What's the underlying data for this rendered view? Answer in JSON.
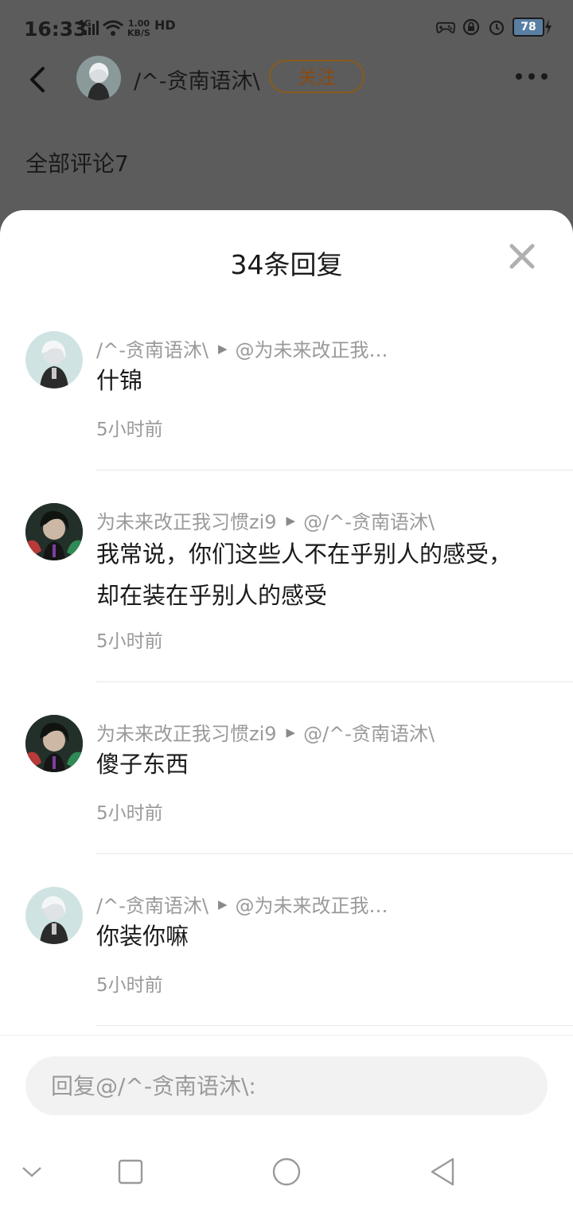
{
  "status_bar": {
    "time": "16:33",
    "network": "4G",
    "speed_value": "1.00",
    "speed_unit": "KB/S",
    "hd": "HD",
    "battery": "78"
  },
  "nav": {
    "name": "/^-贪南语沐\\",
    "follow_label": "关注"
  },
  "page": {
    "all_comments": "全部评论7"
  },
  "sheet": {
    "title": "34条回复"
  },
  "replies": [
    {
      "author": "/^-贪南语沐\\",
      "reply_to": "@为未来改正我…",
      "content": "什锦",
      "time": "5小时前"
    },
    {
      "author": "为未来改正我习惯zi9",
      "reply_to": "@/^-贪南语沐\\",
      "content": "我常说，你们这些人不在乎别人的感受，却在装在乎别人的感受",
      "time": "5小时前"
    },
    {
      "author": "为未来改正我习惯zi9",
      "reply_to": "@/^-贪南语沐\\",
      "content": "傻子东西",
      "time": "5小时前"
    },
    {
      "author": "/^-贪南语沐\\",
      "reply_to": "@为未来改正我…",
      "content": "你装你嘛",
      "time": "5小时前"
    }
  ],
  "input": {
    "placeholder": "回复@/^-贪南语沐\\:"
  },
  "colors": {
    "follow_border": "#8a5a1a",
    "meta_text": "#9a9a9a",
    "battery_fill": "#5a7fa3"
  }
}
